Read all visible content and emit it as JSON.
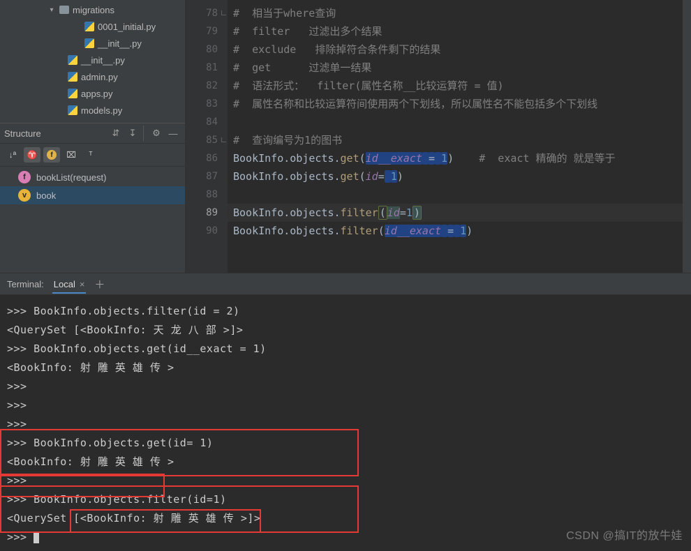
{
  "project_tree": {
    "items": [
      {
        "indent": 60,
        "arrow": "▾",
        "icon": "folder",
        "label": "migrations"
      },
      {
        "indent": 96,
        "arrow": "",
        "icon": "python",
        "label": "0001_initial.py"
      },
      {
        "indent": 96,
        "arrow": "",
        "icon": "python",
        "label": "__init__.py"
      },
      {
        "indent": 72,
        "arrow": "",
        "icon": "python",
        "label": "__init__.py"
      },
      {
        "indent": 72,
        "arrow": "",
        "icon": "python",
        "label": "admin.py"
      },
      {
        "indent": 72,
        "arrow": "",
        "icon": "python",
        "label": "apps.py"
      },
      {
        "indent": 72,
        "arrow": "",
        "icon": "python",
        "label": "models.py"
      }
    ]
  },
  "structure": {
    "title": "Structure",
    "items": [
      {
        "badge": "f",
        "badge_kind": "pink",
        "label": "bookList(request)",
        "selected": false
      },
      {
        "badge": "v",
        "badge_kind": "yellow",
        "label": "book",
        "selected": true
      }
    ]
  },
  "gutter": [
    "78",
    "79",
    "80",
    "81",
    "82",
    "83",
    "84",
    "85",
    "86",
    "87",
    "88",
    "89",
    "90"
  ],
  "current_line": "89",
  "code_lines": {
    "l78": "#  相当于where查询",
    "l79": "#  filter   过滤出多个结果",
    "l80": "#  exclude   排除掉符合条件剩下的结果",
    "l81": "#  get      过滤单一结果",
    "l82": "#  语法形式：  filter(属性名称__比较运算符 = 值)",
    "l83": "#  属性名称和比较运算符间使用两个下划线，所以属性名不能包括多个下划线",
    "l85": "#  查询编号为1的图书",
    "l86a": "BookInfo.objects.",
    "l86b": "get",
    "l86c": "(",
    "l86d": "id__exact",
    "l86e": "=",
    "l86f": "1",
    "l86g": ")    ",
    "l86h": "#  exact 精确的 就是等于",
    "l87a": "BookInfo.objects.",
    "l87b": "get",
    "l87c": "(",
    "l87d": "id",
    "l87e": "=",
    "l87f": "1",
    "l87g": ")",
    "l89a": "BookInfo.objects.",
    "l89b": "filter",
    "l89c": "(",
    "l89d": "id",
    "l89e": "=",
    "l89f": "1",
    "l89g": ")",
    "l90a": "BookInfo.objects.",
    "l90b": "filter",
    "l90c": "(",
    "l90d": "id__exact",
    "l90e": "=",
    "l90f": "1",
    "l90g": ")"
  },
  "terminal": {
    "title": "Terminal:",
    "tab": "Local",
    "lines": [
      ">>> BookInfo.objects.filter(id = 2)",
      "<QuerySet [<BookInfo: 天 龙 八 部 >]>",
      ">>> BookInfo.objects.get(id__exact = 1)",
      "<BookInfo: 射 雕 英 雄 传 >",
      ">>>",
      ">>>",
      ">>>",
      ">>> BookInfo.objects.get(id= 1)",
      "<BookInfo: 射 雕 英 雄 传 >",
      ">>>",
      ">>> BookInfo.objects.filter(id=1)",
      "<QuerySet [<BookInfo: 射 雕 英 雄 传 >]>",
      ">>> "
    ]
  },
  "watermark": "CSDN @搞IT的放牛娃"
}
